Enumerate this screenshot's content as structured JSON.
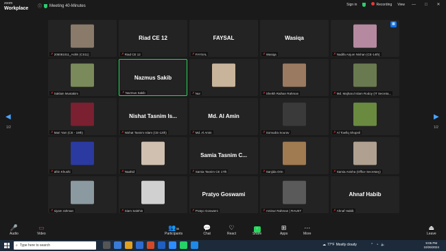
{
  "app": {
    "logo_line1": "zoom",
    "logo_line2": "Workplace",
    "meeting_title": "Meeting 40-Minutes"
  },
  "topbar": {
    "signin": "Sign in",
    "recording": "Recording",
    "view": "View"
  },
  "tiles": [
    {
      "label": "205081011_Ashik (CS11)",
      "big": "",
      "photo": "#8a7a6a"
    },
    {
      "label": "Riad CE 12",
      "big": "Riad CE 12",
      "photo": ""
    },
    {
      "label": "FAYSAL",
      "big": "FAYSAL",
      "photo": ""
    },
    {
      "label": "Wasiqa",
      "big": "Wasiqa",
      "photo": ""
    },
    {
      "label": "Nadifa Anjum Nishan (CE-14th)",
      "big": "",
      "photo": "#b58aa0"
    },
    {
      "label": "Saklain Mustakim",
      "big": "",
      "photo": "#7a8a5a"
    },
    {
      "label": "Nazmus Sakib",
      "big": "Nazmus Sakib",
      "photo": ""
    },
    {
      "label": "Nur",
      "big": "",
      "photo": "#c8b49a"
    },
    {
      "label": "Sheikh Raihan Rahman",
      "big": "",
      "photo": "#9a7a60"
    },
    {
      "label": "Md. Majharul Islam Rodoy (IT Secreta...",
      "big": "",
      "photo": "#6a7a50"
    },
    {
      "label": "Mari Yam (CE - 19th)",
      "big": "",
      "photo": "#7a2030"
    },
    {
      "label": "Nishat Tasnim Islam (CE-12th)",
      "big": "Nishat Tasnim Is...",
      "photo": ""
    },
    {
      "label": "Md. Al Amin",
      "big": "Md. Al Amin",
      "photo": ""
    },
    {
      "label": "Somudra Sourav",
      "big": "",
      "photo": "#3a3a3a"
    },
    {
      "label": "Al Towfiq Shopnil",
      "big": "",
      "photo": "#6a8a40"
    },
    {
      "label": "afrin Khushi",
      "big": "",
      "photo": "#2a3aa0"
    },
    {
      "label": "Naahid",
      "big": "",
      "photo": "#d0c0b0"
    },
    {
      "label": "Samia Tasnim CE 17th",
      "big": "Samia Tasnim C...",
      "photo": ""
    },
    {
      "label": "Sanjida Orin",
      "big": "",
      "photo": "#a07a50"
    },
    {
      "label": "Samia Anisha (Office Secretary)",
      "big": "",
      "photo": "#b0a090"
    },
    {
      "label": "siyam rahman",
      "big": "",
      "photo": "#8a9aa0"
    },
    {
      "label": "Siam Salehin",
      "big": "",
      "photo": "#d0d0d0"
    },
    {
      "label": "Pratyo Goswami",
      "big": "Pratyo Goswami",
      "photo": ""
    },
    {
      "label": "Aminur Rahman | RAUET",
      "big": "",
      "photo": "#5a5a5a"
    },
    {
      "label": "Ahnaf Habib",
      "big": "Ahnaf Habib",
      "photo": ""
    }
  ],
  "nav": {
    "left_page": "1/2",
    "right_page": "1/2"
  },
  "toolbar": {
    "audio": "Audio",
    "video": "Video",
    "participants": "Participants",
    "participants_count": "35",
    "chat": "Chat",
    "react": "React",
    "share": "Share",
    "apps": "Apps",
    "more": "More",
    "leave": "Leave"
  },
  "taskbar": {
    "search_placeholder": "Type here to search",
    "temp": "77°F",
    "weather": "Mostly cloudy",
    "time": "9:05 PM",
    "date": "10/26/2024"
  }
}
